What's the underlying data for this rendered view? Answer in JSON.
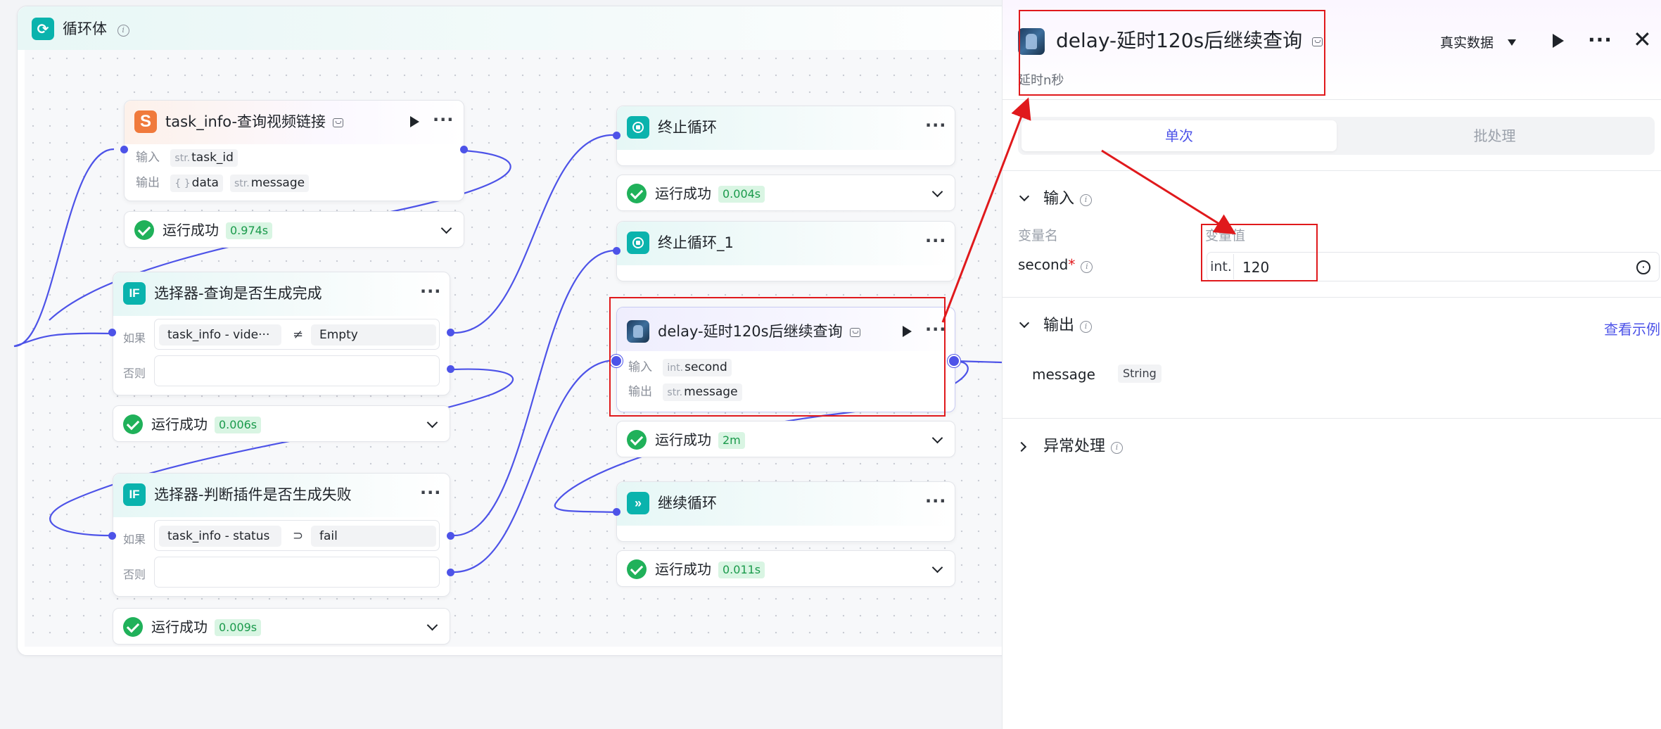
{
  "loop": {
    "title": "循环体"
  },
  "node_task_info": {
    "title": "task_info-查询视频链接",
    "input_label": "输入",
    "output_label": "输出",
    "input_type": "str.",
    "input_name": "task_id",
    "output1_type": "{ }",
    "output1_name": "data",
    "output2_type": "str.",
    "output2_name": "message",
    "status": "运行成功",
    "time": "0.974s"
  },
  "node_selector1": {
    "title": "选择器-查询是否生成完成",
    "if_label": "如果",
    "else_label": "否则",
    "left": "task_info  -  vide···",
    "op": "≠",
    "right": "Empty",
    "status": "运行成功",
    "time": "0.006s"
  },
  "node_selector2": {
    "title": "选择器-判断插件是否生成失败",
    "if_label": "如果",
    "else_label": "否则",
    "left": "task_info  -  status",
    "op": "⊃",
    "right": "fail",
    "status": "运行成功",
    "time": "0.009s"
  },
  "node_stop": {
    "title": "终止循环",
    "status": "运行成功",
    "time": "0.004s"
  },
  "node_stop1": {
    "title": "终止循环_1"
  },
  "node_delay": {
    "title": "delay-延时120s后继续查询",
    "input_label": "输入",
    "output_label": "输出",
    "input_type": "int.",
    "input_name": "second",
    "output_type": "str.",
    "output_name": "message",
    "status": "运行成功",
    "time": "2m"
  },
  "node_continue": {
    "title": "继续循环",
    "status": "运行成功",
    "time": "0.011s"
  },
  "panel": {
    "title": "delay-延时120s后继续查询",
    "subtitle": "延时n秒",
    "mode": "真实数据",
    "tab_single": "单次",
    "tab_batch": "批处理",
    "input_section": "输入",
    "col_name": "变量名",
    "col_value": "变量值",
    "var_name": "second",
    "var_type": "int.",
    "var_value": "120",
    "output_section": "输出",
    "view_example": "查看示例",
    "output_name": "message",
    "output_type": "String",
    "error_section": "异常处理"
  },
  "colors": {
    "accent": "#4d53e8",
    "success": "#20b15a",
    "teal": "#0ab3ad",
    "orange": "#f07a3c",
    "highlight_red": "#e0191c"
  }
}
